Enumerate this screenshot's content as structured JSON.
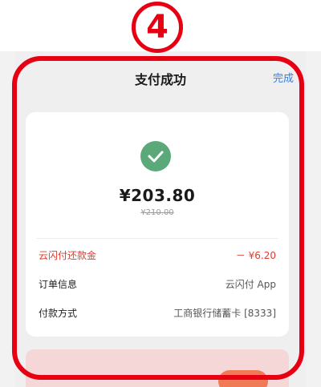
{
  "annotation": {
    "step_number": "4"
  },
  "header": {
    "title": "支付成功",
    "done_label": "完成"
  },
  "payment": {
    "amount": "¥203.80",
    "original_amount": "¥210.00",
    "status_icon": "check-circle-icon"
  },
  "details": {
    "discount": {
      "label": "云闪付还款金",
      "value": "－ ¥6.20"
    },
    "order": {
      "label": "订单信息",
      "value": "云闪付 App"
    },
    "method": {
      "label": "付款方式",
      "value": "工商银行储蓄卡 [8333]"
    }
  },
  "colors": {
    "annotation": "#e60012",
    "success": "#5ba878",
    "link": "#3b7ddd",
    "discount": "#e03a2e"
  }
}
